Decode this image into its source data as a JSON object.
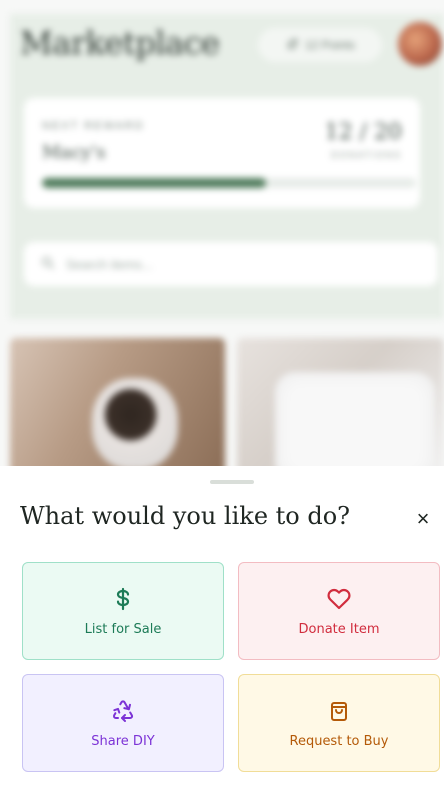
{
  "background": {
    "title": "Marketplace",
    "points_label": "12 Points",
    "reward": {
      "kicker": "NEXT REWARD",
      "store": "Macy's",
      "count": "12 / 20",
      "count_label": "DONATIONS",
      "progress": 0.6
    },
    "search_placeholder": "Search items..."
  },
  "sheet": {
    "title": "What would you like to do?",
    "close_label": "×",
    "options": [
      {
        "label": "List for Sale",
        "icon": "dollar-icon",
        "color": "#1d7b57"
      },
      {
        "label": "Donate Item",
        "icon": "heart-icon",
        "color": "#d12d3e"
      },
      {
        "label": "Share DIY",
        "icon": "recycle-icon",
        "color": "#7c33d6"
      },
      {
        "label": "Request to Buy",
        "icon": "shopping-bag-icon",
        "color": "#b45a08"
      }
    ]
  }
}
